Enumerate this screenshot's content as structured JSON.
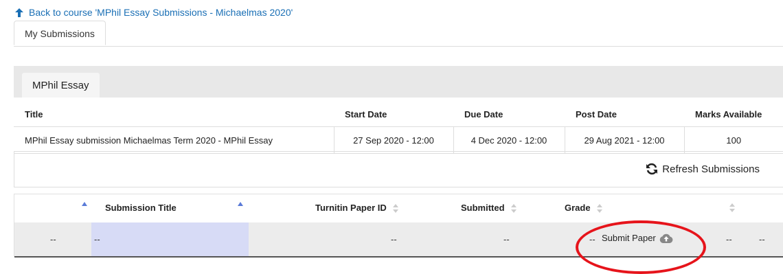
{
  "nav": {
    "back_label": "Back to course 'MPhil Essay Submissions - Michaelmas 2020'"
  },
  "tabs": {
    "my_submissions": "My Submissions"
  },
  "assignment_tab": "MPhil Essay",
  "info_table": {
    "headers": [
      "Title",
      "Start Date",
      "Due Date",
      "Post Date",
      "Marks Available"
    ],
    "row": [
      "MPhil Essay submission Michaelmas Term 2020 - MPhil Essay",
      "27 Sep 2020 - 12:00",
      "4 Dec 2020 - 12:00",
      "29 Aug 2021 - 12:00",
      "100"
    ]
  },
  "refresh_label": "Refresh Submissions",
  "submissions": {
    "headers": {
      "title": "Submission Title",
      "paper_id": "Turnitin Paper ID",
      "submitted": "Submitted",
      "grade": "Grade"
    },
    "row": {
      "col1": "--",
      "title": "--",
      "paper_id": "--",
      "submitted": "--",
      "grade": "--",
      "submit_label": "Submit Paper",
      "col_a": "--",
      "col_b": "--"
    }
  },
  "colors": {
    "link": "#1a6fb5",
    "highlight": "#d7dbf6",
    "annotation": "#e6141b"
  }
}
